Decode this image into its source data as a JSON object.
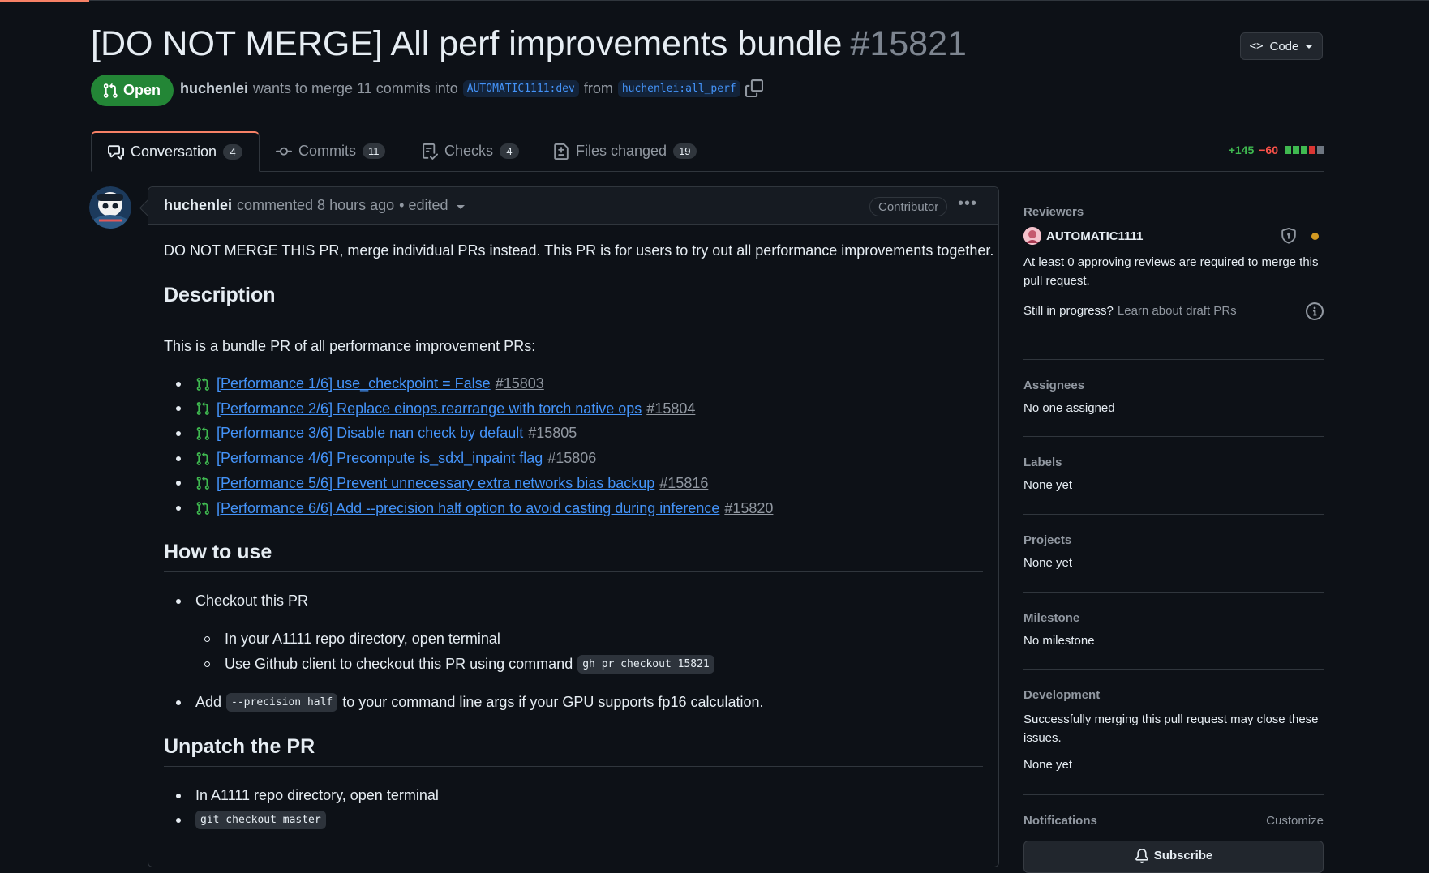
{
  "header": {
    "title": "[DO NOT MERGE] All perf improvements bundle",
    "number": "#15821",
    "code_button": "Code",
    "code_icon": "<>"
  },
  "state": {
    "label": "Open",
    "color": "#238636",
    "author": "huchenlei",
    "wants_text": "wants to merge 11 commits into",
    "base_branch": "AUTOMATIC1111:dev",
    "from_text": "from",
    "head_branch": "huchenlei:all_perf"
  },
  "tabs": [
    {
      "label": "Conversation",
      "count": "4",
      "active": true
    },
    {
      "label": "Commits",
      "count": "11"
    },
    {
      "label": "Checks",
      "count": "4"
    },
    {
      "label": "Files changed",
      "count": "19"
    }
  ],
  "diffstat": {
    "additions": "+145",
    "deletions": "−60"
  },
  "comment": {
    "author": "huchenlei",
    "commented_text": "commented 8 hours ago",
    "edited_text": "• edited",
    "role_badge": "Contributor",
    "intro": "DO NOT MERGE THIS PR, merge individual PRs instead. This PR is for users to try out all performance improvements together.",
    "h_description": "Description",
    "description_text": "This is a bundle PR of all performance improvement PRs:",
    "prs": [
      {
        "title": "[Performance 1/6] use_checkpoint = False",
        "number": "#15803"
      },
      {
        "title": "[Performance 2/6] Replace einops.rearrange with torch native ops",
        "number": "#15804"
      },
      {
        "title": "[Performance 3/6] Disable nan check by default",
        "number": "#15805"
      },
      {
        "title": "[Performance 4/6] Precompute is_sdxl_inpaint flag",
        "number": "#15806"
      },
      {
        "title": "[Performance 5/6] Prevent unnecessary extra networks bias backup",
        "number": "#15816"
      },
      {
        "title": "[Performance 6/6] Add --precision half option to avoid casting during inference",
        "number": "#15820"
      }
    ],
    "h_howto": "How to use",
    "howto_checkout": "Checkout this PR",
    "howto_sub1": "In your A1111 repo directory, open terminal",
    "howto_sub2": "Use Github client to checkout this PR using command",
    "howto_sub2_code": "gh pr checkout 15821",
    "howto_add": "Add",
    "howto_add_code": "--precision half",
    "howto_add_rest": "to your command line args if your GPU supports fp16 calculation.",
    "h_unpatch": "Unpatch the PR",
    "unpatch_1": "In A1111 repo directory, open terminal",
    "unpatch_2_code": "git checkout master"
  },
  "sidebar": {
    "reviewers_label": "Reviewers",
    "reviewer_name": "AUTOMATIC1111",
    "reviewers_note": "At least 0 approving reviews are required to merge this pull request.",
    "draft_q": "Still in progress?",
    "draft_link": "Learn about draft PRs",
    "assignees_label": "Assignees",
    "assignees_value": "No one assigned",
    "labels_label": "Labels",
    "labels_value": "None yet",
    "projects_label": "Projects",
    "projects_value": "None yet",
    "milestone_label": "Milestone",
    "milestone_value": "No milestone",
    "development_label": "Development",
    "development_note": "Successfully merging this pull request may close these issues.",
    "development_value": "None yet",
    "notifications_label": "Notifications",
    "customize": "Customize",
    "subscribe": "Subscribe"
  },
  "colors": {
    "link": "#4493f8",
    "open_green": "#238636",
    "background": "#0d1117"
  }
}
